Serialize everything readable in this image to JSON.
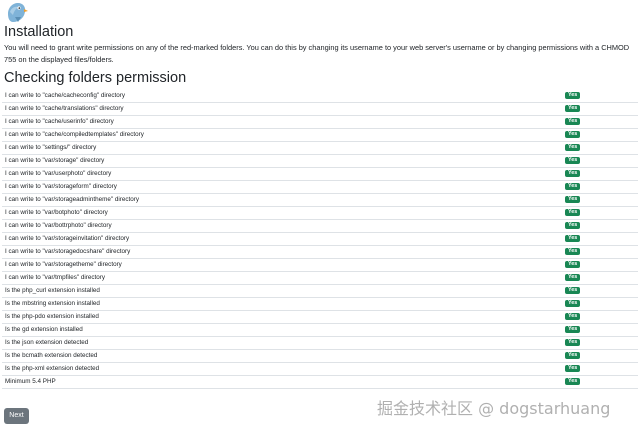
{
  "header": {
    "logo_icon": "bird-logo-icon"
  },
  "installation": {
    "title": "Installation",
    "intro": "You will need to grant write permissions on any of the red-marked folders. You can do this by changing its username to your web server's username or by changing permissions with a CHMOD 755 on the displayed files/folders."
  },
  "checks": {
    "title": "Checking folders permission",
    "rows": [
      {
        "label": "I can write to \"cache/cacheconfig\" directory",
        "status": "Yes"
      },
      {
        "label": "I can write to \"cache/translations\" directory",
        "status": "Yes"
      },
      {
        "label": "I can write to \"cache/userinfo\" directory",
        "status": "Yes"
      },
      {
        "label": "I can write to \"cache/compiledtemplates\" directory",
        "status": "Yes"
      },
      {
        "label": "I can write to \"settings/\" directory",
        "status": "Yes"
      },
      {
        "label": "I can write to \"var/storage\" directory",
        "status": "Yes"
      },
      {
        "label": "I can write to \"var/userphoto\" directory",
        "status": "Yes"
      },
      {
        "label": "I can write to \"var/storageform\" directory",
        "status": "Yes"
      },
      {
        "label": "I can write to \"var/storageadmintheme\" directory",
        "status": "Yes"
      },
      {
        "label": "I can write to \"var/botphoto\" directory",
        "status": "Yes"
      },
      {
        "label": "I can write to \"var/bottrphoto\" directory",
        "status": "Yes"
      },
      {
        "label": "I can write to \"var/storageinvitation\" directory",
        "status": "Yes"
      },
      {
        "label": "I can write to \"var/storagedocshare\" directory",
        "status": "Yes"
      },
      {
        "label": "I can write to \"var/storagetheme\" directory",
        "status": "Yes"
      },
      {
        "label": "I can write to \"var/tmpfiles\" directory",
        "status": "Yes"
      },
      {
        "label": "Is the php_curl extension installed",
        "status": "Yes"
      },
      {
        "label": "Is the mbstring extension installed",
        "status": "Yes"
      },
      {
        "label": "Is the php-pdo extension installed",
        "status": "Yes"
      },
      {
        "label": "Is the gd extension installed",
        "status": "Yes"
      },
      {
        "label": "Is the json extension detected",
        "status": "Yes"
      },
      {
        "label": "Is the bcmath extension detected",
        "status": "Yes"
      },
      {
        "label": "Is the php-xml extension detected",
        "status": "Yes"
      },
      {
        "label": "Minimum 5.4 PHP",
        "status": "Yes"
      }
    ]
  },
  "actions": {
    "next_label": "Next"
  },
  "watermark": {
    "text": "掘金技术社区 @ dogstarhuang"
  },
  "colors": {
    "success_badge": "#198754",
    "button_secondary": "#6c757d",
    "row_divider": "#dee2e6",
    "logo_body": "#7fb3d8",
    "logo_beak": "#f0a030"
  }
}
